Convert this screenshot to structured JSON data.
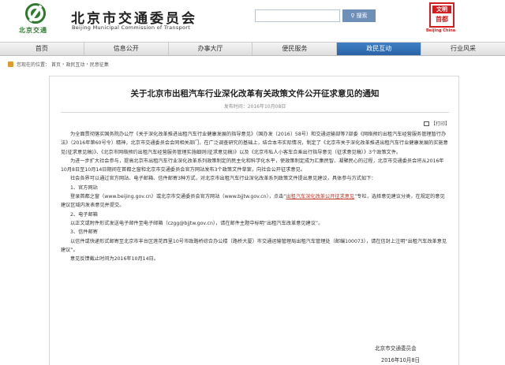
{
  "header": {
    "logo_text": "北京交通",
    "site_title": "北京市交通委员会",
    "site_subtitle": "Beijing Municipal Commission of Transport",
    "search_button": "搜索",
    "search_value": "",
    "emblem_top": "文明",
    "emblem_mid": "首都",
    "emblem_caption": "Beijing China"
  },
  "nav": {
    "items": [
      "首页",
      "信息公开",
      "办事大厅",
      "便民服务",
      "政民互动",
      "行业风采"
    ],
    "active": "政民互动"
  },
  "breadcrumb": {
    "prefix": "您现在的位置：",
    "items": [
      "首页",
      "政民互动",
      "民意征集"
    ],
    "sep": "›"
  },
  "article": {
    "title": "关于北京市出租汽车行业深化改革有关政策文件公开征求意见的通知",
    "date": "发布时间：2016年10月08日",
    "print_label": "【打印】",
    "para1": "为全面贯彻落实国务院办公厅《关于深化改革推进出租汽车行业健康发展的指导意见》（国办发〔2016〕58号）和交通运输部等7部委《网络预约出租汽车经营服务管理暂行办法》（2016年第60号令）精神，北京市交通委员会会同相关部门，在广泛调查研究的基础上，结合本市实际情况，制定了《北京市关于深化改革推进出租汽车行业健康发展的实施意见(征求意见稿)》、《北京市网络预约出租汽车经营服务管理实施细则(征求意见稿)》以及《北京市私人小客车合乘出行指导意见（征求意见稿）》3个政策文件。",
    "para2": "为进一步扩大社会参与，提高北京市出租汽车行业深化改革系列政策制定的民主化和科学化水平，使政策制定成为汇集民智、凝聚民心的过程，北京市交通委员会将从2016年10月8日至10月14日期间在首都之窗和北京市交通委员会官方网站发布3个政策文件草案，向社会公开征求意见。",
    "para3": "社会各界可以通过官方网站、电子邮箱、信件邮寄3种方式，对北京市出租汽车行业深化改革系列政策文件提出意见建议，具体参与方式如下：",
    "h1": "1、官方网站",
    "p_web_a": "登录首都之窗（www.beijing.gov.cn）或北京市交通委员会官方网站（www.bjjtw.gov.cn），点击“",
    "p_web_link": "出租汽车深化改革公开征求意见",
    "p_web_b": "”专栏，选择意见建议分类，在规定的意见建议区域内发表意见并提交。",
    "h2": "2、电子邮箱",
    "p_mail": "以正文或附件形式发送电子邮件至电子邮箱（czgg@bjjtw.gov.cn），请在邮件主题中标明“出租汽车改革意见建议”。",
    "h3": "3、信件邮寄",
    "p_post": "以信件或快递形式邮寄至北京市丰台区莲花西里10号市政路桥综合办公楼（路桥大厦）市交通运输管理局出租汽车管理处（邮编100073），请在信封上注明“出租汽车改革意见建议”。",
    "deadline": "意见反馈截止时间为2016年10月14日。",
    "sign": "北京市交通委员会",
    "sign_date": "2016年10月8日"
  },
  "colors": {
    "nav_active": "#2a63a6",
    "link_red": "#c0392b",
    "logo_green": "#2d7a2d",
    "search_blue": "#6d8fb8"
  }
}
